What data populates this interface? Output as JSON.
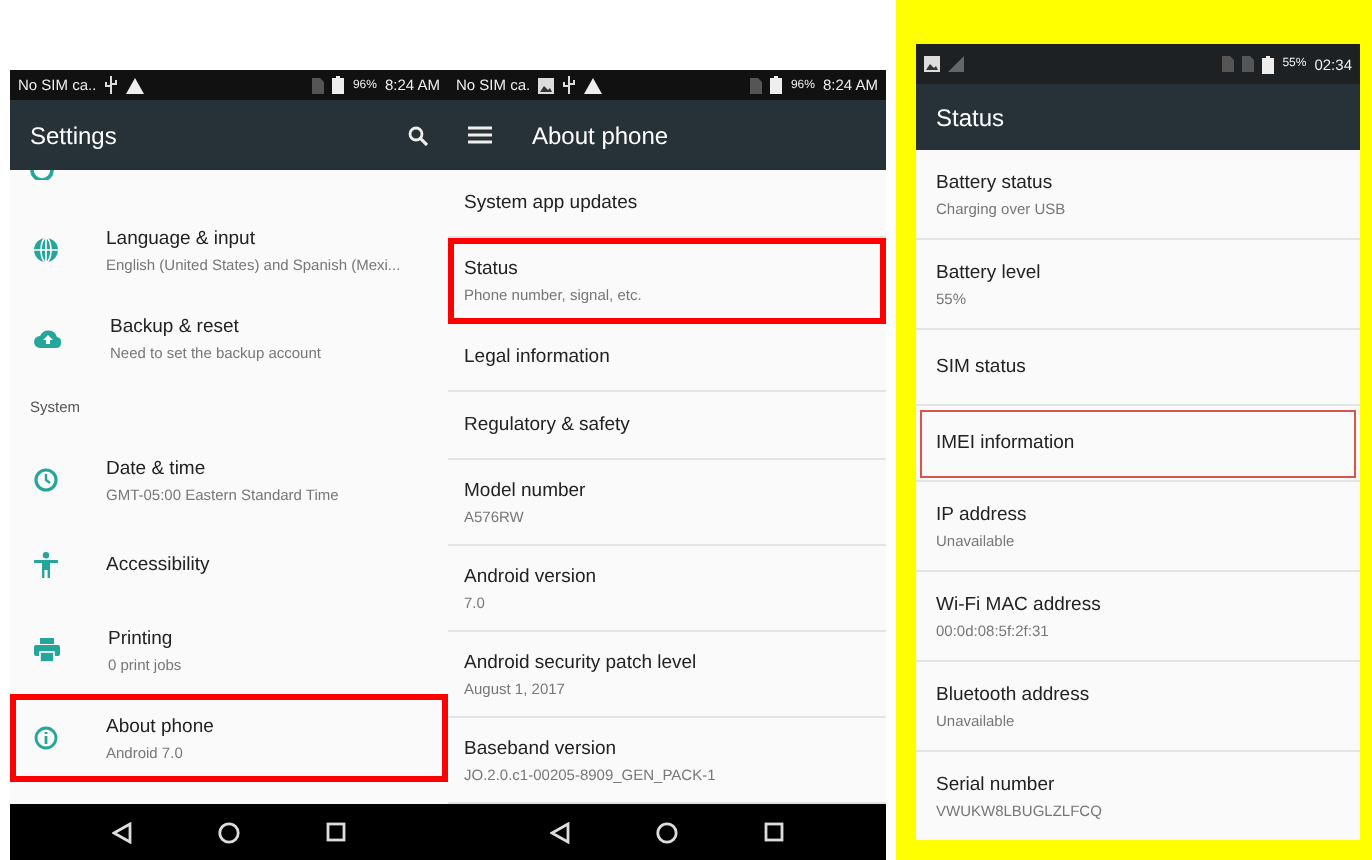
{
  "screens": [
    {
      "status_bar": {
        "carrier": "No SIM ca..",
        "battery": "96%",
        "time": "8:24 AM"
      },
      "toolbar": {
        "title": "Settings"
      },
      "items": [
        {
          "kind": "entry",
          "title": "Language & input",
          "subtitle": "English (United States) and Spanish (Mexi...",
          "highlighted": false
        },
        {
          "kind": "entry",
          "title": "Backup & reset",
          "subtitle": "Need to set the backup account",
          "highlighted": false
        },
        {
          "kind": "header",
          "title": "System"
        },
        {
          "kind": "entry",
          "title": "Date & time",
          "subtitle": "GMT-05:00 Eastern Standard Time",
          "highlighted": false
        },
        {
          "kind": "entry",
          "title": "Accessibility",
          "highlighted": false
        },
        {
          "kind": "entry",
          "title": "Printing",
          "subtitle": "0 print jobs",
          "highlighted": false
        },
        {
          "kind": "entry",
          "title": "About phone",
          "subtitle": "Android 7.0",
          "highlighted": true
        }
      ]
    },
    {
      "status_bar": {
        "carrier": "No SIM ca.",
        "battery": "96%",
        "time": "8:24 AM"
      },
      "toolbar": {
        "title": "About phone"
      },
      "items": [
        {
          "kind": "entry",
          "title": "System app updates",
          "highlighted": false
        },
        {
          "kind": "entry",
          "title": "Status",
          "subtitle": "Phone number, signal, etc.",
          "highlighted": true
        },
        {
          "kind": "entry",
          "title": "Legal information",
          "highlighted": false
        },
        {
          "kind": "entry",
          "title": "Regulatory & safety",
          "highlighted": false
        },
        {
          "kind": "entry",
          "title": "Model number",
          "subtitle": "A576RW",
          "highlighted": false
        },
        {
          "kind": "entry",
          "title": "Android version",
          "subtitle": "7.0",
          "highlighted": false
        },
        {
          "kind": "entry",
          "title": "Android security patch level",
          "subtitle": "August 1, 2017",
          "highlighted": false
        },
        {
          "kind": "entry",
          "title": "Baseband version",
          "subtitle": "JO.2.0.c1-00205-8909_GEN_PACK-1",
          "highlighted": false
        }
      ]
    },
    {
      "status_bar": {
        "battery": "55%",
        "time": "02:34"
      },
      "toolbar": {
        "title": "Status"
      },
      "items": [
        {
          "kind": "entry",
          "title": "Battery status",
          "subtitle": "Charging over USB",
          "highlighted": false
        },
        {
          "kind": "entry",
          "title": "Battery level",
          "subtitle": "55%",
          "highlighted": false
        },
        {
          "kind": "entry",
          "title": "SIM status",
          "highlighted": false
        },
        {
          "kind": "entry",
          "title": "IMEI information",
          "highlighted": true
        },
        {
          "kind": "entry",
          "title": "IP address",
          "subtitle": "Unavailable",
          "highlighted": false
        },
        {
          "kind": "entry",
          "title": "Wi-Fi MAC address",
          "subtitle": "00:0d:08:5f:2f:31",
          "highlighted": false
        },
        {
          "kind": "entry",
          "title": "Bluetooth address",
          "subtitle": "Unavailable",
          "highlighted": false
        },
        {
          "kind": "entry",
          "title": "Serial number",
          "subtitle": "VWUKW8LBUGLZLFCQ",
          "highlighted": false
        }
      ]
    }
  ]
}
